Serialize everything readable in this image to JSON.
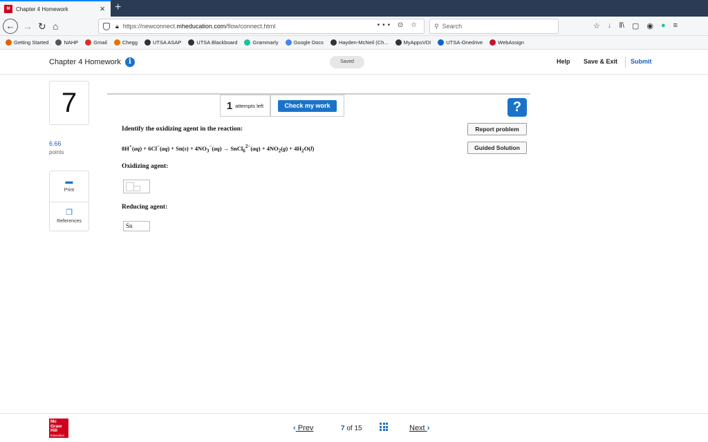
{
  "browser": {
    "tab_title": "Chapter 4 Homework",
    "tab_close": "×",
    "new_tab": "+",
    "url_domain_prefix": "https://newconnect.",
    "url_domain": "mheducation.com",
    "url_path": "/flow/connect.html",
    "url_actions": "••• ⊙ ☆",
    "search_placeholder": "Search",
    "bookmarks": [
      {
        "label": "Getting Started",
        "color": "#e66000"
      },
      {
        "label": "NAHP",
        "color": "#555555"
      },
      {
        "label": "Gmail",
        "color": "#d93025"
      },
      {
        "label": "Chegg",
        "color": "#eb7100"
      },
      {
        "label": "UTSA ASAP",
        "color": "#333333"
      },
      {
        "label": "UTSA Blackboard",
        "color": "#333333"
      },
      {
        "label": "Grammarly",
        "color": "#15c39a"
      },
      {
        "label": "Google Docs",
        "color": "#4285f4"
      },
      {
        "label": "Hayden-McNeil (Ch...",
        "color": "#333333"
      },
      {
        "label": "MyAppsVDI",
        "color": "#333333"
      },
      {
        "label": "UTSA-Onedrive",
        "color": "#0a64d2"
      },
      {
        "label": "WebAssign",
        "color": "#c8102e"
      }
    ]
  },
  "header": {
    "title": "Chapter 4 Homework",
    "saved": "Saved",
    "help": "Help",
    "save_exit": "Save & Exit",
    "submit": "Submit"
  },
  "sidebar": {
    "question_number": "7",
    "points_value": "6.66",
    "points_label": "points",
    "print": "Print",
    "references": "References"
  },
  "question": {
    "attempts_count": "1",
    "attempts_label": "attempts left",
    "check_button": "Check my work",
    "help_icon": "?",
    "report_problem": "Report problem",
    "guided_solution": "Guided Solution",
    "prompt": "Identify the oxidizing agent in the reaction:",
    "oxidizing_label": "Oxidizing agent:",
    "reducing_label": "Reducing agent:",
    "reducing_value": "Sn"
  },
  "footer": {
    "logo": "Mc Graw Hill Education",
    "prev": "Prev",
    "current": "7",
    "of": "of",
    "total": "15",
    "next": "Next"
  }
}
